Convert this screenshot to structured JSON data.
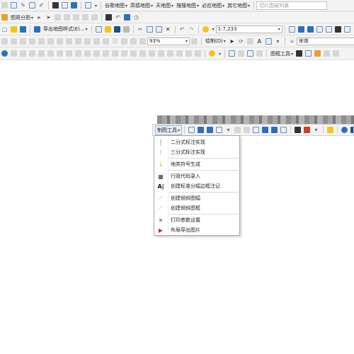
{
  "toolbar1": {
    "menus": [
      "谷歌地图",
      "高德地图",
      "天地图",
      "搜搜地图",
      "必应地图",
      "其它地图"
    ],
    "search_placeholder": "切片图层列表",
    "tile_split_label": "图斑分割"
  },
  "toolbar2": {
    "export_style_label": "导出地图样式(E)...",
    "scale_value": "1:7,233"
  },
  "toolbar3": {
    "draw_label": "绘制(D)",
    "font_value": "宋体"
  },
  "toolbar4": {
    "zoom_value": "93%",
    "frame_tools_label": "图框工具"
  },
  "floating_toolbar": {
    "draw_tools_label": "制图工具"
  },
  "dropdown_menu": {
    "items": [
      {
        "label": "二分式标注实现",
        "icon": "fraction-2-icon"
      },
      {
        "label": "三分式标注实现",
        "icon": "fraction-3-icon"
      },
      {
        "label": "地类符号生成",
        "icon": "arrow-down-icon"
      },
      {
        "label": "行政代码录入",
        "icon": "admin-code-icon"
      },
      {
        "label": "创建标准分幅边框注记",
        "icon": "annotation-icon"
      },
      {
        "label": "创建倾斜图幅",
        "icon": "tilted-sheet-icon"
      },
      {
        "label": "创建倾斜图框",
        "icon": "tilted-frame-icon"
      },
      {
        "label": "打印参数设置",
        "icon": "print-settings-icon"
      },
      {
        "label": "布局导出图片",
        "icon": "export-image-icon"
      }
    ]
  }
}
